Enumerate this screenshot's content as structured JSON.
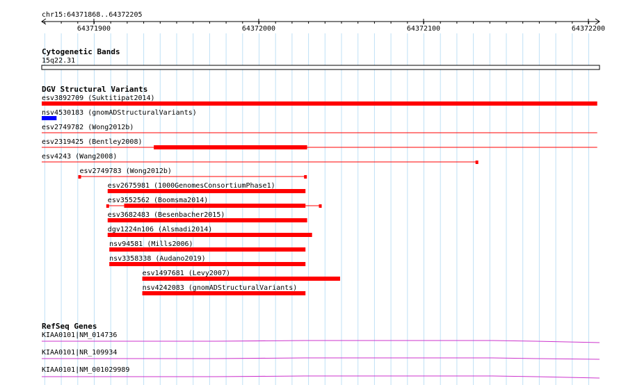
{
  "region": "chr15:64371868..64372205",
  "ruler": {
    "ticks": [
      "64371900",
      "64372000",
      "64372100",
      "64372200"
    ]
  },
  "colors": {
    "grid": "#bfe0f5",
    "variant": "#ff0000",
    "loss": "#0000ff",
    "gene": "#cc33cc"
  },
  "cytoband": {
    "title": "Cytogenetic Bands",
    "band": "15q22.31"
  },
  "dgv": {
    "title": "DGV Structural Variants",
    "items": [
      {
        "label": "esv3892709 (Suktitipat2014)",
        "start": 64371868,
        "end": 64372205,
        "style": "thick",
        "color": "red"
      },
      {
        "label": "nsv4530183 (gnomADStructuralVariants)",
        "start": 64371868,
        "end": 64371877,
        "style": "thick",
        "color": "blue"
      },
      {
        "label": "esv2749782 (Wong2012b)",
        "start": 64371868,
        "end": 64372205,
        "style": "thin",
        "color": "red"
      },
      {
        "label": "esv2319425 (Bentley2008)",
        "start": 64371868,
        "end": 64372205,
        "style": "thin",
        "color": "red",
        "block": [
          64371936,
          64372029
        ]
      },
      {
        "label": "esv4243 (Wang2008)",
        "start": 64371868,
        "end": 64372132,
        "style": "thin",
        "color": "red",
        "endcap": true
      },
      {
        "label": "esv2749783 (Wong2012b)",
        "start": 64371891,
        "end": 64372028,
        "style": "thin",
        "color": "red",
        "caps": true
      },
      {
        "label": "esv2675981 (1000GenomesConsortiumPhase1)",
        "start": 64371908,
        "end": 64372028,
        "style": "thick",
        "color": "red"
      },
      {
        "label": "esv3552562 (Boomsma2014)",
        "start": 64371908,
        "end": 64372037,
        "style": "thin",
        "color": "red",
        "caps": true,
        "block": [
          64371918,
          64372028
        ]
      },
      {
        "label": "esv3682483 (Besenbacher2015)",
        "start": 64371908,
        "end": 64372029,
        "style": "thick",
        "color": "red"
      },
      {
        "label": "dgv1224n106 (Alsmadi2014)",
        "start": 64371908,
        "end": 64372032,
        "style": "thick",
        "color": "red"
      },
      {
        "label": "nsv94581 (Mills2006)",
        "start": 64371909,
        "end": 64372028,
        "style": "thick",
        "color": "red"
      },
      {
        "label": "nsv3358338 (Audano2019)",
        "start": 64371909,
        "end": 64372028,
        "style": "thick",
        "color": "red"
      },
      {
        "label": "esv1497681 (Levy2007)",
        "start": 64371929,
        "end": 64372049,
        "style": "thick",
        "color": "red"
      },
      {
        "label": "nsv4242083 (gnomADStructuralVariants)",
        "start": 64371929,
        "end": 64372028,
        "style": "thick",
        "color": "red"
      }
    ]
  },
  "refseq": {
    "title": "RefSeq Genes",
    "items": [
      {
        "label": "KIAA0101|NM_014736"
      },
      {
        "label": "KIAA0101|NR_109934"
      },
      {
        "label": "KIAA0101|NM_001029989"
      }
    ]
  }
}
